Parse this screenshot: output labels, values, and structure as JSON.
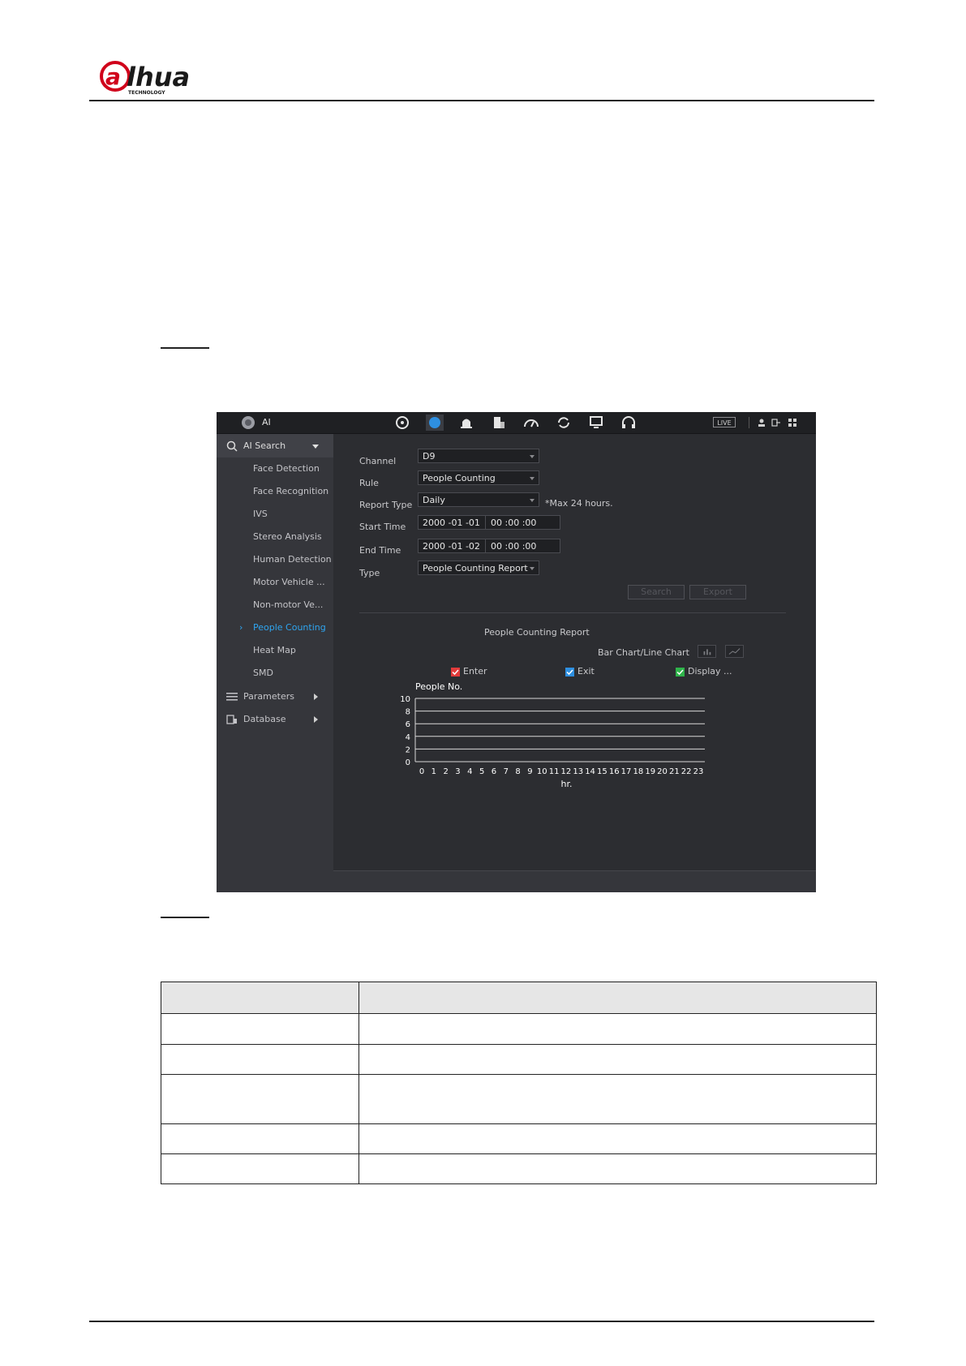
{
  "document": {
    "logo_text": "alhua",
    "logo_subtext": "TECHNOLOGY"
  },
  "app": {
    "title": "AI",
    "toolbar_icons": [
      "search-icon",
      "ai-icon",
      "alarm-icon",
      "storage-icon",
      "performance-icon",
      "backup-icon",
      "display-icon",
      "audio-icon"
    ],
    "live_label": "LIVE"
  },
  "sidebar": {
    "header": "AI Search",
    "items": [
      {
        "label": "Face Detection"
      },
      {
        "label": "Face Recognition"
      },
      {
        "label": "IVS"
      },
      {
        "label": "Stereo Analysis"
      },
      {
        "label": "Human Detection"
      },
      {
        "label": "Motor Vehicle ..."
      },
      {
        "label": "Non-motor Ve..."
      },
      {
        "label": "People Counting",
        "selected": true
      },
      {
        "label": "Heat Map"
      },
      {
        "label": "SMD"
      }
    ],
    "groups": [
      {
        "label": "Parameters"
      },
      {
        "label": "Database"
      }
    ]
  },
  "form": {
    "channel_label": "Channel",
    "channel_value": "D9",
    "rule_label": "Rule",
    "rule_value": "People Counting",
    "report_type_label": "Report Type",
    "report_type_value": "Daily",
    "report_type_note": "*Max 24 hours.",
    "start_time_label": "Start Time",
    "start_date": "2000 -01 -01",
    "start_time": "00 :00 :00",
    "end_time_label": "End Time",
    "end_date": "2000 -01 -02",
    "end_time": "00 :00 :00",
    "type_label": "Type",
    "type_value": "People Counting Report",
    "search_button": "Search",
    "export_button": "Export"
  },
  "report": {
    "title": "People Counting Report",
    "chart_switch_label": "Bar Chart/Line Chart",
    "legend": [
      {
        "label": "Enter",
        "color": "#e23b3b"
      },
      {
        "label": "Exit",
        "color": "#2e8fe0"
      },
      {
        "label": "Display ...",
        "color": "#2fb34a"
      }
    ]
  },
  "chart_data": {
    "type": "line",
    "ylabel": "People No.",
    "xlabel": "hr.",
    "ylim": [
      0,
      10
    ],
    "yticks": [
      0,
      2,
      4,
      6,
      8,
      10
    ],
    "x": [
      0,
      1,
      2,
      3,
      4,
      5,
      6,
      7,
      8,
      9,
      10,
      11,
      12,
      13,
      14,
      15,
      16,
      17,
      18,
      19,
      20,
      21,
      22,
      23
    ],
    "series": [],
    "grid": true
  }
}
